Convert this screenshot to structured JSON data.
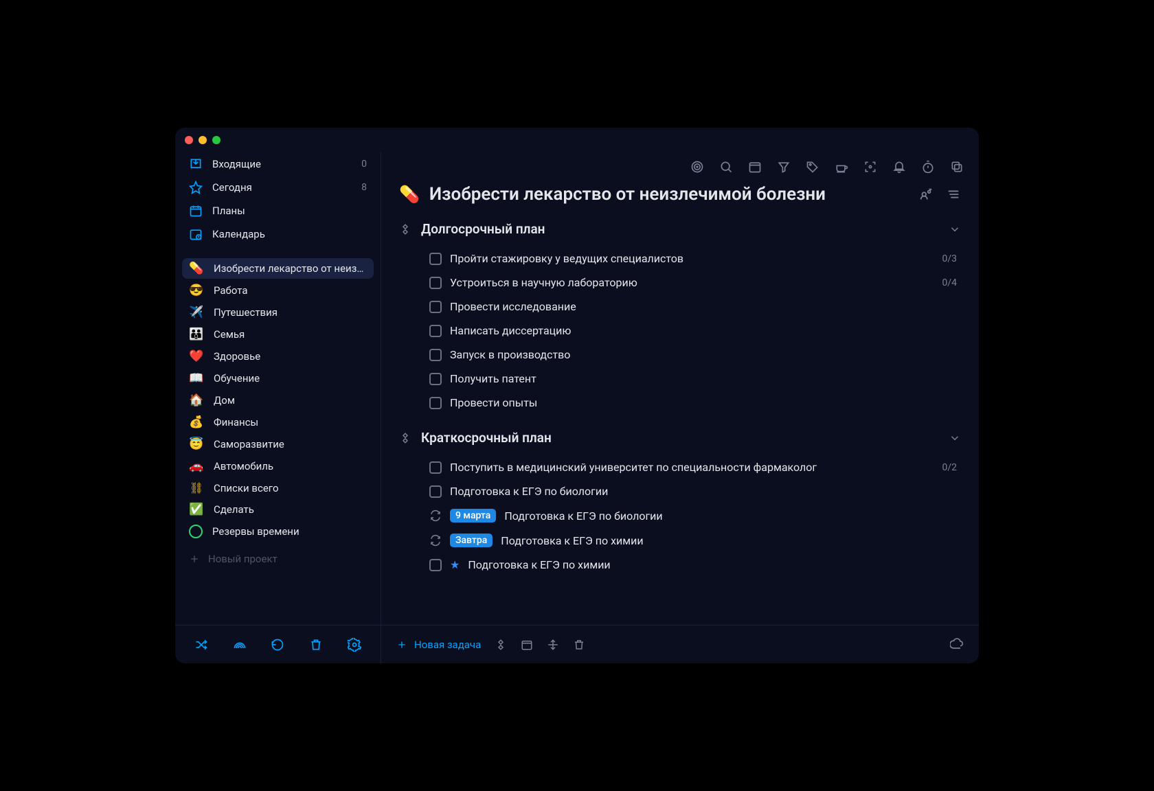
{
  "sidebar": {
    "nav": [
      {
        "icon": "inbox",
        "label": "Входящие",
        "count": "0",
        "accent": true
      },
      {
        "icon": "star",
        "label": "Сегодня",
        "count": "8",
        "accent": true
      },
      {
        "icon": "calendar-grid",
        "label": "Планы",
        "count": "",
        "accent": false
      },
      {
        "icon": "calendar-clock",
        "label": "Календарь",
        "count": "",
        "accent": false
      }
    ],
    "projects": [
      {
        "emoji": "💊",
        "label": "Изобрести лекарство от неизлечимой болезни",
        "active": true
      },
      {
        "emoji": "😎",
        "label": "Работа"
      },
      {
        "emoji": "✈️",
        "label": "Путешествия"
      },
      {
        "emoji": "👪",
        "label": "Семья"
      },
      {
        "emoji": "❤️",
        "label": "Здоровье"
      },
      {
        "emoji": "📖",
        "label": "Обучение"
      },
      {
        "emoji": "🏠",
        "label": "Дом"
      },
      {
        "emoji": "💰",
        "label": "Финансы"
      },
      {
        "emoji": "😇",
        "label": "Саморазвитие"
      },
      {
        "emoji": "🚗",
        "label": "Автомобиль"
      },
      {
        "emoji": "chain",
        "label": "Списки всего"
      },
      {
        "emoji": "✅",
        "label": "Сделать"
      },
      {
        "emoji": "ring",
        "label": "Резервы времени"
      }
    ],
    "new_project": "Новый проект"
  },
  "header": {
    "emoji": "💊",
    "title": "Изобрести лекарство от неизлечимой болезни"
  },
  "sections": [
    {
      "title": "Долгосрочный план",
      "tasks": [
        {
          "kind": "check",
          "label": "Пройти стажировку у ведущих специалистов",
          "progress": "0/3"
        },
        {
          "kind": "check",
          "label": "Устроиться в научную лабораторию",
          "progress": "0/4"
        },
        {
          "kind": "check",
          "label": "Провести исследование"
        },
        {
          "kind": "check",
          "label": "Написать диссертацию"
        },
        {
          "kind": "check",
          "label": "Запуск в производство"
        },
        {
          "kind": "check",
          "label": "Получить патент"
        },
        {
          "kind": "check",
          "label": "Провести опыты"
        }
      ]
    },
    {
      "title": "Краткосрочный план",
      "tasks": [
        {
          "kind": "check",
          "label": "Поступить в медицинский университет по специальности фармаколог",
          "progress": "0/2"
        },
        {
          "kind": "check",
          "label": "Подготовка к ЕГЭ по биологии"
        },
        {
          "kind": "recur",
          "pill": "9 марта",
          "label": "Подготовка к ЕГЭ по биологии"
        },
        {
          "kind": "recur",
          "pill": "Завтра",
          "label": "Подготовка к ЕГЭ по химии"
        },
        {
          "kind": "check",
          "star": true,
          "label": "Подготовка к ЕГЭ по химии"
        }
      ]
    }
  ],
  "footer": {
    "new_task": "Новая задача"
  }
}
